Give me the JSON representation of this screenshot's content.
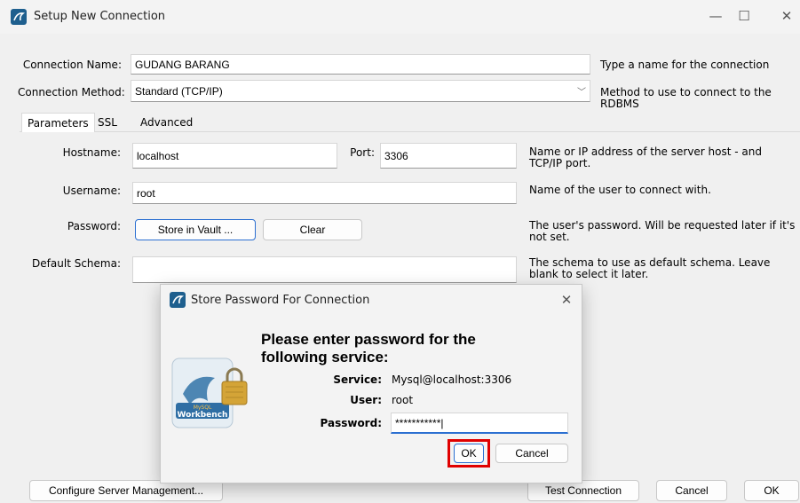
{
  "window": {
    "title": "Setup New Connection",
    "min": "—",
    "max": "☐",
    "close": "✕"
  },
  "form": {
    "connection_name_label": "Connection Name:",
    "connection_name_value": "GUDANG BARANG",
    "connection_name_desc": "Type a name for the connection",
    "connection_method_label": "Connection Method:",
    "connection_method_value": "Standard (TCP/IP)",
    "connection_method_desc": "Method to use to connect to the RDBMS"
  },
  "tabs": [
    {
      "label": "Parameters"
    },
    {
      "label": "SSL"
    },
    {
      "label": "Advanced"
    }
  ],
  "params": {
    "hostname_label": "Hostname:",
    "hostname_value": "localhost",
    "port_label": "Port:",
    "port_value": "3306",
    "host_desc_1": "Name or IP address of the server host - and",
    "host_desc_2": "TCP/IP port.",
    "username_label": "Username:",
    "username_value": "root",
    "username_desc": "Name of the user to connect with.",
    "password_label": "Password:",
    "store_vault_label": "Store in Vault ...",
    "clear_label": "Clear",
    "password_desc_1": "The user's password. Will be requested later if it's",
    "password_desc_2": "not set.",
    "schema_label": "Default Schema:",
    "schema_value": "",
    "schema_desc_1": "The schema to use as default schema. Leave",
    "schema_desc_2": "blank to select it later."
  },
  "footer": {
    "configure_label": "Configure Server Management...",
    "test_label": "Test Connection",
    "cancel_label": "Cancel",
    "ok_label": "OK"
  },
  "modal": {
    "title": "Store Password For Connection",
    "close": "✕",
    "heading_1": "Please enter password for the",
    "heading_2": "following service:",
    "service_label": "Service:",
    "service_value": "Mysql@localhost:3306",
    "user_label": "User:",
    "user_value": "root",
    "password_label": "Password:",
    "password_value": "***********|",
    "ok_label": "OK",
    "cancel_label": "Cancel",
    "logo_text": "Workbench",
    "logo_small": "MySQL"
  },
  "colors": {
    "accent": "#2b6fd1",
    "highlight": "#e00000",
    "app_icon": "#1e5f8e"
  }
}
